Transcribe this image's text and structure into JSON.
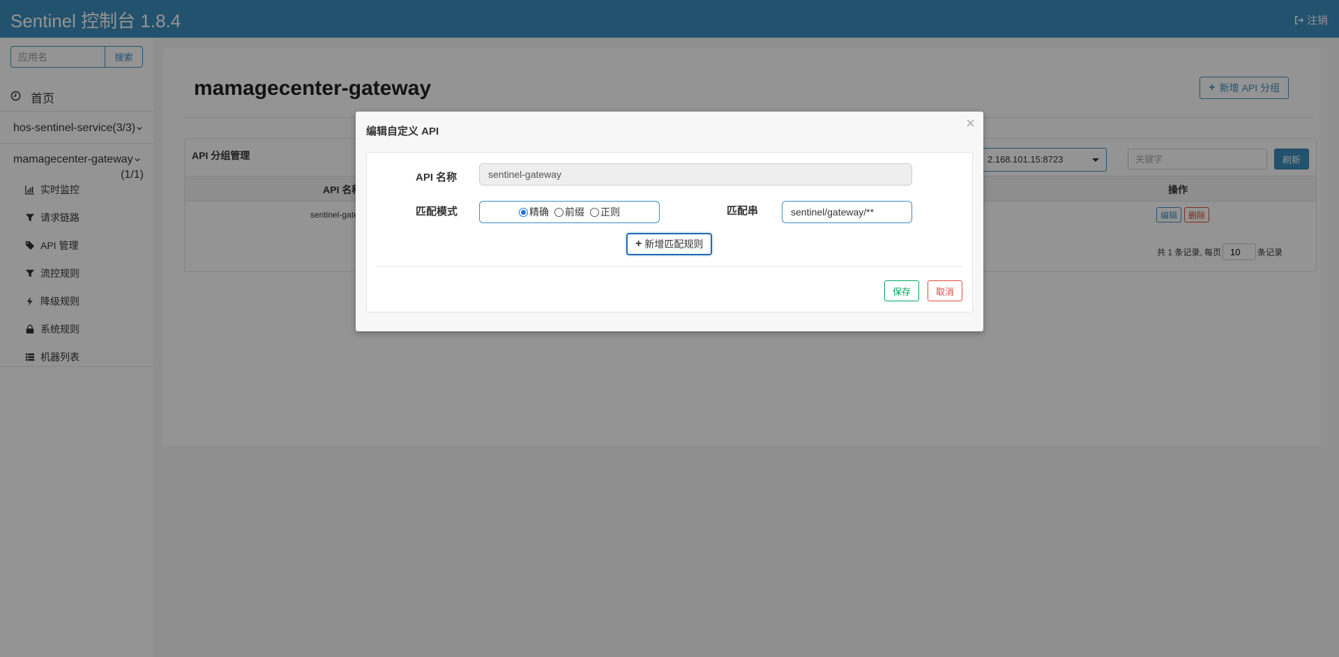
{
  "header": {
    "brand": "Sentinel 控制台 1.8.4",
    "logout_label": "注销"
  },
  "sidebar": {
    "search_placeholder": "应用名",
    "search_button": "搜索",
    "home_label": "首页",
    "apps": [
      {
        "name": "hos-sentinel-service(3/3)"
      },
      {
        "name": "mamagecenter-gateway",
        "count": "(1/1)"
      }
    ],
    "menu": [
      {
        "label": "实时监控",
        "icon": "bar-chart-icon"
      },
      {
        "label": "请求链路",
        "icon": "filter-icon"
      },
      {
        "label": "API 管理",
        "icon": "tags-icon"
      },
      {
        "label": "流控规则",
        "icon": "filter-icon"
      },
      {
        "label": "降级规则",
        "icon": "bolt-icon"
      },
      {
        "label": "系统规则",
        "icon": "lock-icon"
      },
      {
        "label": "机器列表",
        "icon": "list-icon"
      }
    ]
  },
  "main": {
    "page_title": "mamagecenter-gateway",
    "add_group_button": "新增 API 分组",
    "box_title": "API 分组管理",
    "machine_select": "2.168.101.15:8723",
    "keyword_placeholder": "关键字",
    "refresh_button": "刷新",
    "table": {
      "col_name": "API 名称",
      "col_op": "操作",
      "rows": [
        {
          "name": "sentinel-gatewa",
          "edit": "编辑",
          "delete": "删除"
        }
      ]
    },
    "pager": {
      "prefix": "共 1 条记录, 每页",
      "page_size": "10",
      "suffix": "条记录"
    }
  },
  "modal": {
    "title": "编辑自定义 API",
    "close": "×",
    "api_name_label": "API 名称",
    "api_name_value": "sentinel-gateway",
    "match_mode_label": "匹配模式",
    "match_modes": [
      {
        "label": "精确",
        "checked": true
      },
      {
        "label": "前缀",
        "checked": false
      },
      {
        "label": "正则",
        "checked": false
      }
    ],
    "pattern_label": "匹配串",
    "pattern_value": "sentinel/gateway/**",
    "add_rule_button": "新增匹配规则",
    "save_button": "保存",
    "cancel_button": "取消"
  }
}
